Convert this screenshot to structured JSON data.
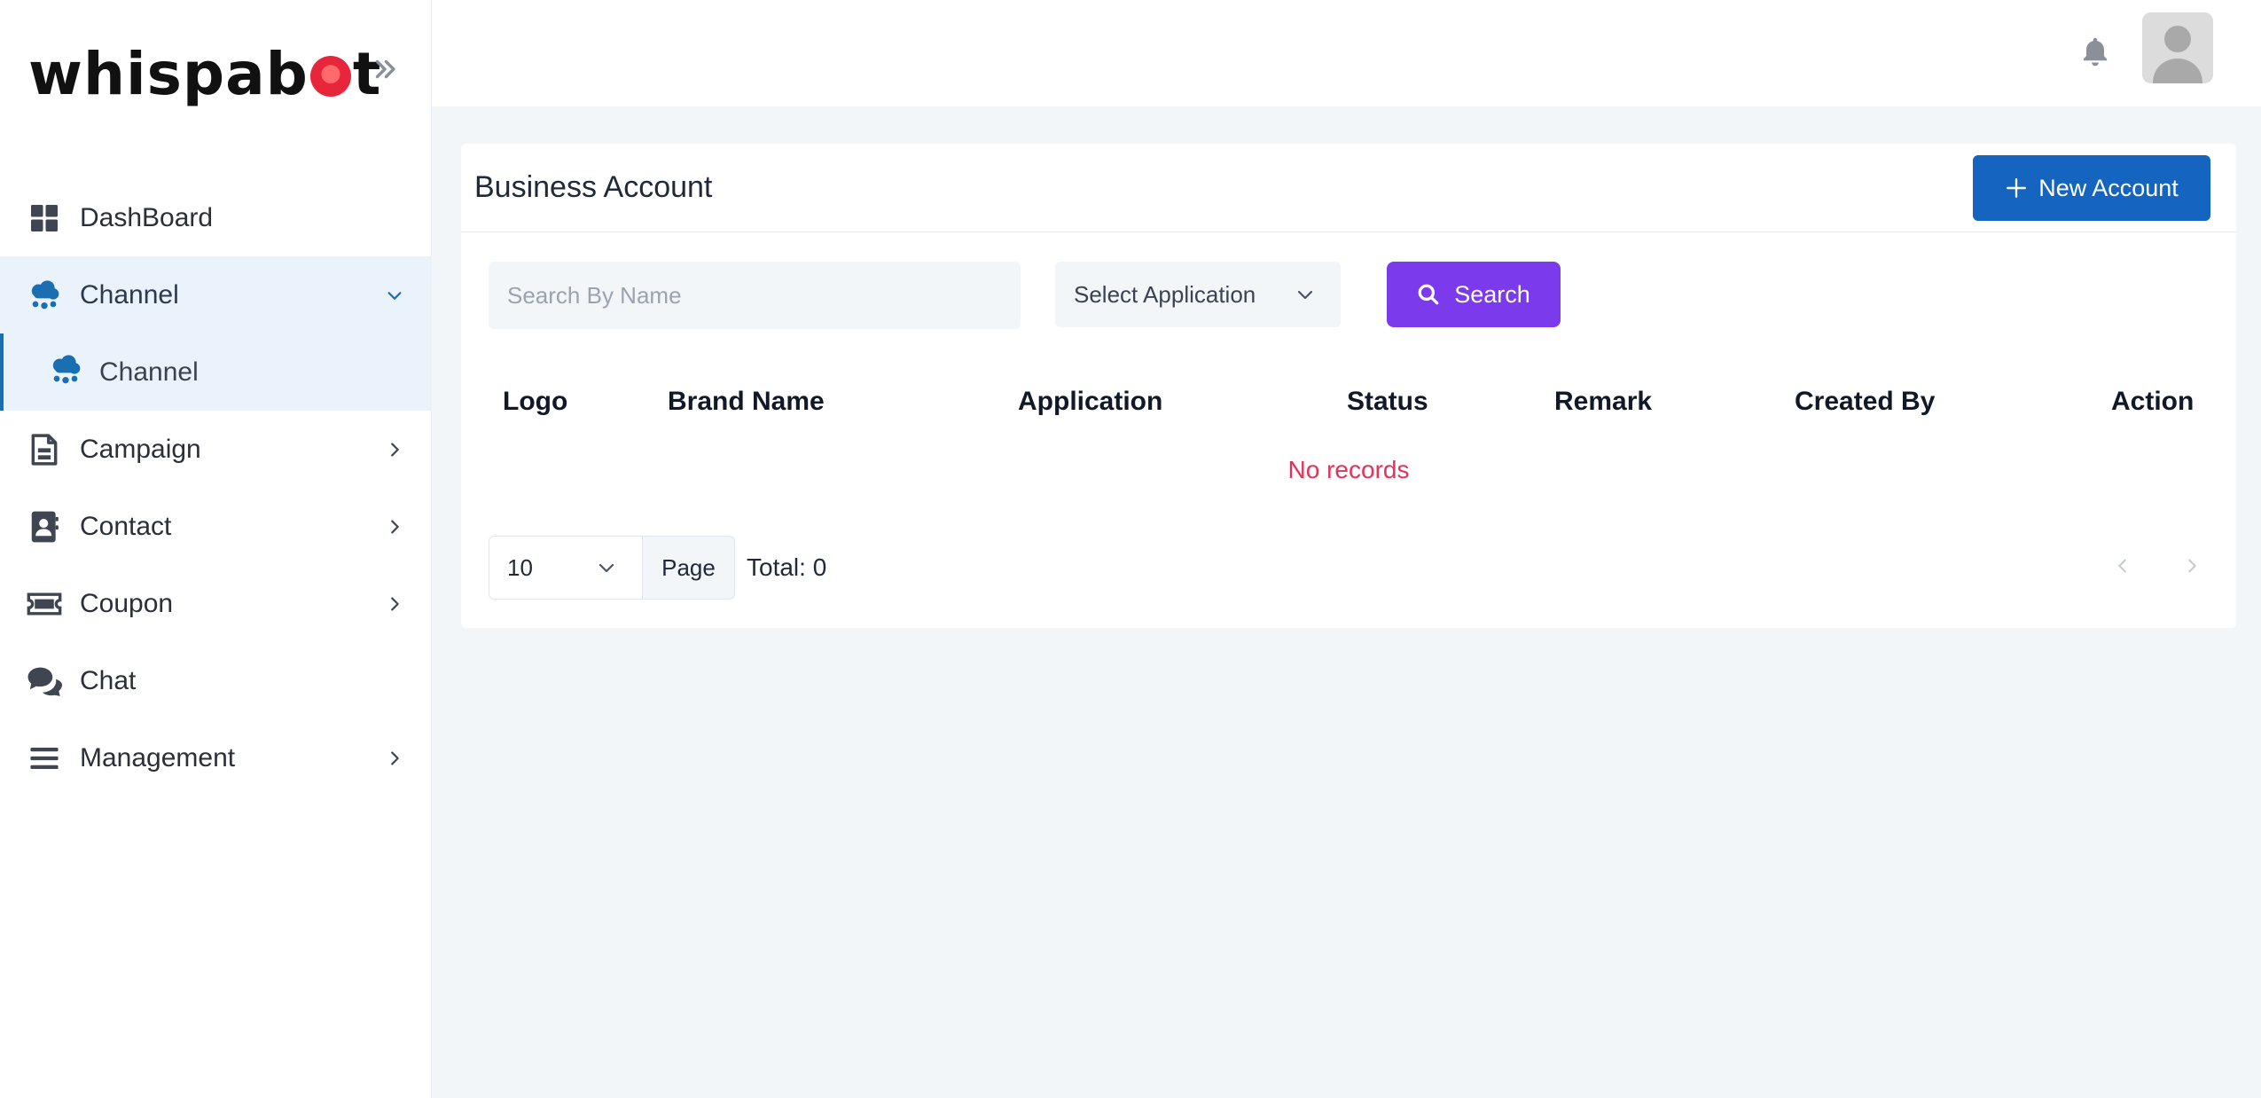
{
  "brand": {
    "name_left": "whispab",
    "name_right": "t"
  },
  "sidebar": {
    "items": [
      {
        "label": "DashBoard"
      },
      {
        "label": "Channel"
      },
      {
        "label": "Channel"
      },
      {
        "label": "Campaign"
      },
      {
        "label": "Contact"
      },
      {
        "label": "Coupon"
      },
      {
        "label": "Chat"
      },
      {
        "label": "Management"
      }
    ]
  },
  "page": {
    "title": "Business Account",
    "new_button": "New Account"
  },
  "filters": {
    "search_placeholder": "Search By Name",
    "search_value": "",
    "application_select": "Select Application",
    "search_button": "Search"
  },
  "table": {
    "columns": [
      "Logo",
      "Brand Name",
      "Application",
      "Status",
      "Remark",
      "Created By",
      "Action"
    ],
    "rows": [],
    "empty_message": "No records"
  },
  "pagination": {
    "page_size": "10",
    "page_label": "Page",
    "total": "Total: 0"
  },
  "colors": {
    "primary": "#1565c0",
    "accent": "#7c3aed",
    "danger": "#e5325a",
    "active_bg": "#eaf3fb",
    "channel_icon": "#1a6fb3"
  }
}
